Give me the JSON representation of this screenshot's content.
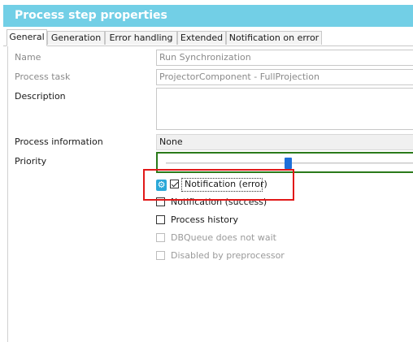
{
  "window": {
    "title": "Process step properties"
  },
  "tabs": [
    {
      "label": "General"
    },
    {
      "label": "Generation"
    },
    {
      "label": "Error handling"
    },
    {
      "label": "Extended"
    },
    {
      "label": "Notification on error"
    }
  ],
  "form": {
    "name": {
      "label": "Name",
      "value": "Run Synchronization"
    },
    "process_task": {
      "label": "Process task",
      "value": "ProjectorComponent - FullProjection"
    },
    "description": {
      "label": "Description",
      "value": ""
    },
    "process_information": {
      "label": "Process information",
      "value": "None"
    },
    "priority": {
      "label": "Priority",
      "level_fraction": 0.5
    }
  },
  "options": [
    {
      "label": "Notification (error)",
      "checked": true,
      "enabled": true
    },
    {
      "label": "Notification (success)",
      "checked": false,
      "enabled": true
    },
    {
      "label": "Process history",
      "checked": false,
      "enabled": true
    },
    {
      "label": "DBQueue does not wait",
      "checked": false,
      "enabled": false
    },
    {
      "label": "Disabled by preprocessor",
      "checked": false,
      "enabled": false
    }
  ],
  "icons": {
    "notification_error_marker": "gear-icon"
  },
  "colors": {
    "title_bar": "#72cfe6",
    "highlight": "#e11919",
    "priority_border": "#2a7a1a",
    "slider_thumb": "#1e6fd9"
  }
}
